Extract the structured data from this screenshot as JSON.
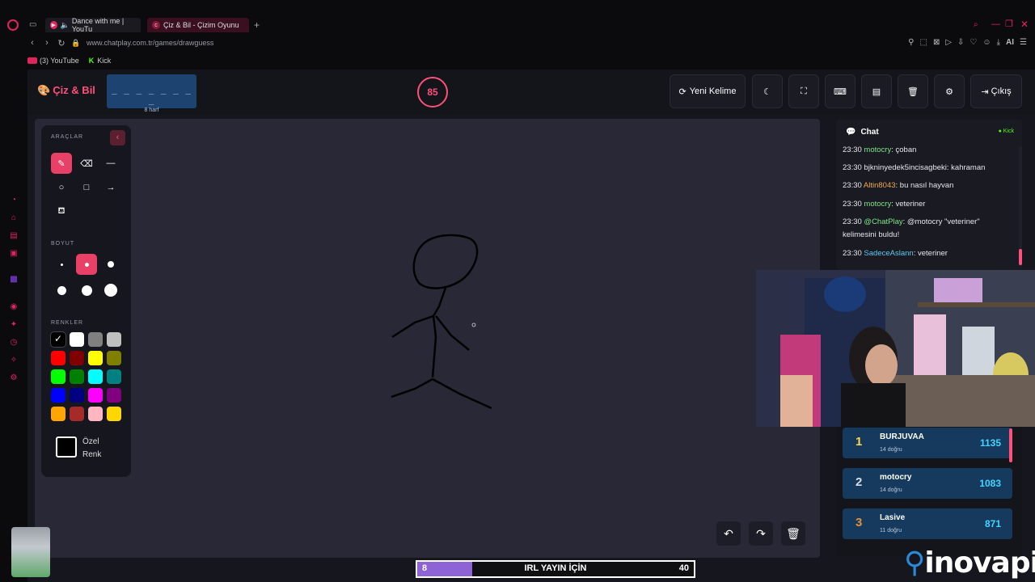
{
  "browser": {
    "tabs": [
      {
        "label": "Dance with me | YouTu"
      },
      {
        "label": "Çiz & Bil - Çizim Oyunu"
      }
    ],
    "url": "www.chatplay.com.tr/games/drawguess",
    "bookmarks": [
      {
        "label": "(3) YouTube"
      },
      {
        "label": "Kick"
      }
    ],
    "ai_label": "AI"
  },
  "game": {
    "logo": "Çiz & Bil",
    "word_dashes": "_ _ _ _ _ _ _ _",
    "word_hint": "8 harf",
    "timer": "85",
    "buttons": {
      "new_word": "Yeni Kelime",
      "exit": "Çıkış"
    }
  },
  "tools": {
    "section_tools": "ARAÇLAR",
    "section_size": "BOYUT",
    "section_colors": "RENKLER",
    "custom_color_label": "Özel Renk",
    "colors": [
      "#000000",
      "#ffffff",
      "#808080",
      "#c0c0c0",
      "#ff0000",
      "#800000",
      "#ffff00",
      "#808000",
      "#00ff00",
      "#008000",
      "#00ffff",
      "#008080",
      "#0000ff",
      "#000080",
      "#ff00ff",
      "#800080",
      "#ffa500",
      "#a52a2a",
      "#ffb6c1",
      "#ffd700"
    ]
  },
  "chat": {
    "title": "Chat",
    "platform": "Kick",
    "messages": [
      {
        "time": "23:30",
        "user": "motocry",
        "user_color": "#7ee787",
        "text": ": çoban"
      },
      {
        "time": "23:30",
        "user": "bjkninyedek5incisagbeki",
        "user_color": "#e6e6ea",
        "text": ": kahraman"
      },
      {
        "time": "23:30",
        "user": "Altin8043",
        "user_color": "#f0a94e",
        "text": ": bu nasıl hayvan"
      },
      {
        "time": "23:30",
        "user": "motocry",
        "user_color": "#7ee787",
        "text": ": veteriner"
      },
      {
        "time": "23:30",
        "user": "@ChatPlay",
        "user_color": "#7ee787",
        "text": ": @motocry \"veteriner\" kelimesini buldu!"
      },
      {
        "time": "23:30",
        "user": "SadeceAslann",
        "user_color": "#5fc9f0",
        "text": ": veteriner"
      }
    ]
  },
  "leaderboard": [
    {
      "rank": "1",
      "name": "BURJUVAA",
      "sub": "14 doğru",
      "score": "1135",
      "rank_color": "#ffd84a"
    },
    {
      "rank": "2",
      "name": "motocry",
      "sub": "14 doğru",
      "score": "1083",
      "rank_color": "#d7dde5"
    },
    {
      "rank": "3",
      "name": "Lasive",
      "sub": "11 doğru",
      "score": "871",
      "rank_color": "#e0913c"
    }
  ],
  "goal": {
    "current": "8",
    "label": "IRL YAYIN İÇİN",
    "target": "40",
    "fill_fraction": 0.2
  },
  "overlay_brand": "inovapin"
}
